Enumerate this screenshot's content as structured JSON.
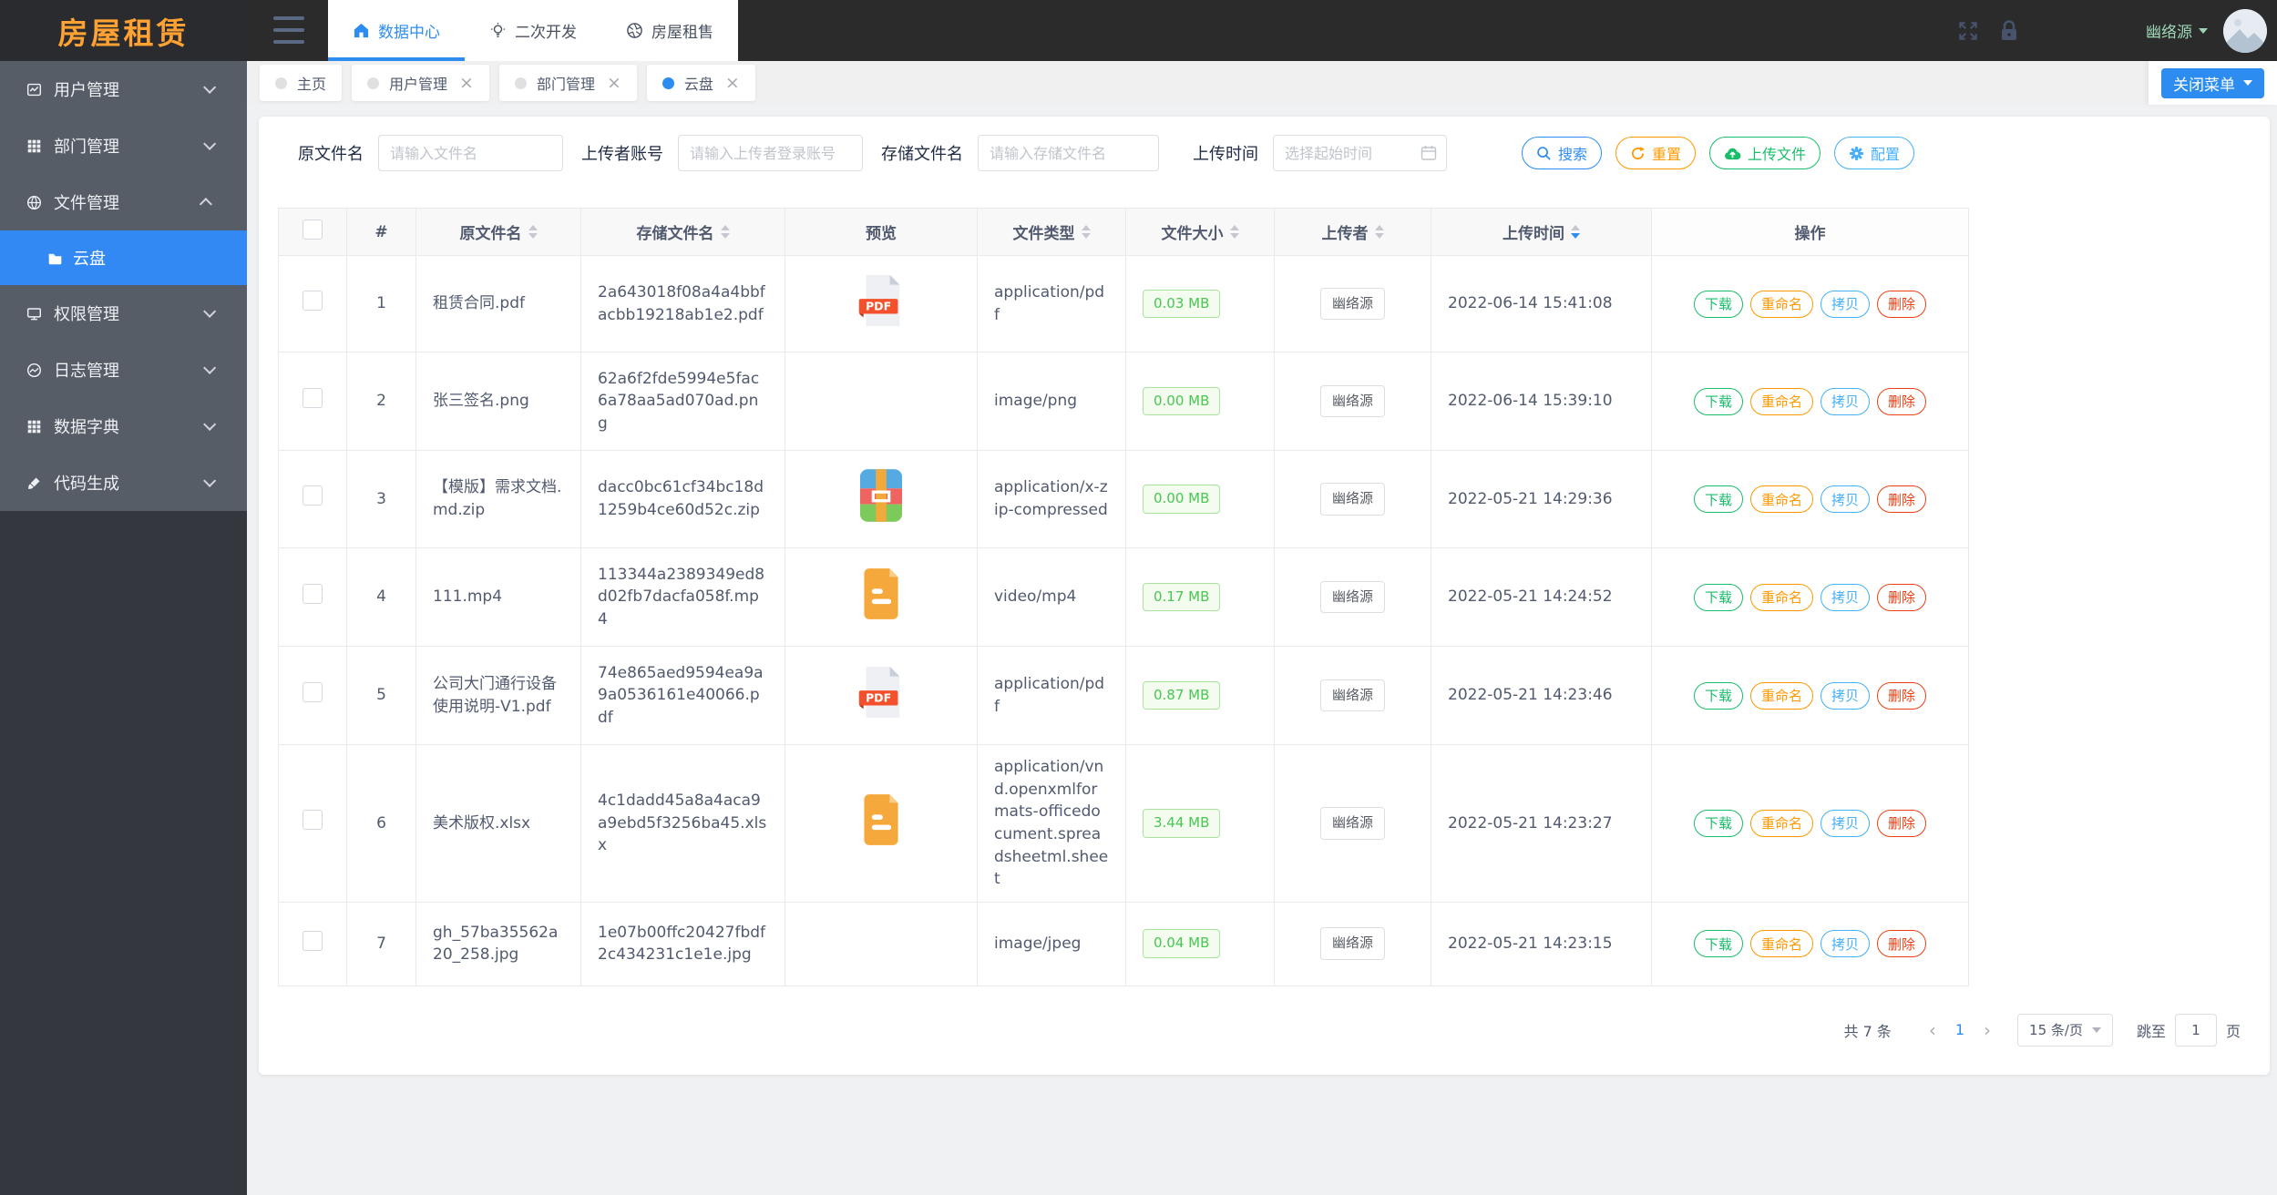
{
  "app": {
    "logo": "房屋租赁"
  },
  "topbar": {
    "nav": [
      {
        "label": "数据中心",
        "icon": "home-icon"
      },
      {
        "label": "二次开发",
        "icon": "bulb-icon"
      },
      {
        "label": "房屋租售",
        "icon": "aperture-icon"
      }
    ],
    "username": "幽络源"
  },
  "tagbar": {
    "tabs": [
      {
        "label": "主页",
        "active": false,
        "closable": false
      },
      {
        "label": "用户管理",
        "active": false,
        "closable": true
      },
      {
        "label": "部门管理",
        "active": false,
        "closable": true
      },
      {
        "label": "云盘",
        "active": true,
        "closable": true
      }
    ],
    "close_icon": "×",
    "close_menu": "关闭菜单"
  },
  "sidebar": {
    "items": [
      {
        "label": "用户管理",
        "icon": "chart-icon",
        "state": "collapsed"
      },
      {
        "label": "部门管理",
        "icon": "grid-icon",
        "state": "collapsed"
      },
      {
        "label": "文件管理",
        "icon": "basketball-icon",
        "state": "expanded"
      },
      {
        "label": "权限管理",
        "icon": "monitor-icon",
        "state": "collapsed"
      },
      {
        "label": "日志管理",
        "icon": "pie-chart-icon",
        "state": "collapsed"
      },
      {
        "label": "数据字典",
        "icon": "dict-grid-icon",
        "state": "collapsed"
      },
      {
        "label": "代码生成",
        "icon": "brush-icon",
        "state": "collapsed"
      }
    ],
    "submenu": {
      "label": "云盘",
      "icon": "folder-icon",
      "active": true
    }
  },
  "filters": {
    "name": {
      "label": "原文件名",
      "placeholder": "请输入文件名"
    },
    "uploader": {
      "label": "上传者账号",
      "placeholder": "请输入上传者登录账号"
    },
    "storage": {
      "label": "存储文件名",
      "placeholder": "请输入存储文件名"
    },
    "time": {
      "label": "上传时间",
      "placeholder": "选择起始时间"
    }
  },
  "toolbar": {
    "search": "搜索",
    "reset": "重置",
    "upload": "上传文件",
    "config": "配置"
  },
  "icons": {
    "pdf_label": "PDF"
  },
  "table": {
    "columns": [
      {
        "label": ""
      },
      {
        "label": "#"
      },
      {
        "label": "原文件名",
        "sortable": true
      },
      {
        "label": "存储文件名",
        "sortable": true
      },
      {
        "label": "预览"
      },
      {
        "label": "文件类型",
        "sortable": true
      },
      {
        "label": "文件大小",
        "sortable": true
      },
      {
        "label": "上传者",
        "sortable": true
      },
      {
        "label": "上传时间",
        "sortable": true,
        "sorted": "desc"
      },
      {
        "label": "操作"
      }
    ],
    "actions": {
      "download": "下载",
      "rename": "重命名",
      "copy": "拷贝",
      "delete": "删除"
    },
    "rows": [
      {
        "index": "1",
        "name": "租赁合同.pdf",
        "storage": "2a643018f08a4a4bbfacbb19218ab1e2.pdf",
        "preview": "pdf",
        "type": "application/pdf",
        "size": "0.03 MB",
        "uploader": "幽络源",
        "time": "2022-06-14 15:41:08"
      },
      {
        "index": "2",
        "name": "张三签名.png",
        "storage": "62a6f2fde5994e5fac6a78aa5ad070ad.png",
        "preview": "none",
        "type": "image/png",
        "size": "0.00 MB",
        "uploader": "幽络源",
        "time": "2022-06-14 15:39:10"
      },
      {
        "index": "3",
        "name": "【模版】需求文档.md.zip",
        "storage": "dacc0bc61cf34bc18d1259b4ce60d52c.zip",
        "preview": "zip",
        "type": "application/x-zip-compressed",
        "size": "0.00 MB",
        "uploader": "幽络源",
        "time": "2022-05-21 14:29:36"
      },
      {
        "index": "4",
        "name": "111.mp4",
        "storage": "113344a2389349ed8d02fb7dacfa058f.mp4",
        "preview": "doc",
        "type": "video/mp4",
        "size": "0.17 MB",
        "uploader": "幽络源",
        "time": "2022-05-21 14:24:52"
      },
      {
        "index": "5",
        "name": "公司大门通行设备使用说明-V1.pdf",
        "storage": "74e865aed9594ea9a9a0536161e40066.pdf",
        "preview": "pdf",
        "type": "application/pdf",
        "size": "0.87 MB",
        "uploader": "幽络源",
        "time": "2022-05-21 14:23:46"
      },
      {
        "index": "6",
        "name": "美术版权.xlsx",
        "storage": "4c1dadd45a8a4aca9a9ebd5f3256ba45.xlsx",
        "preview": "doc",
        "type": "application/vnd.openxmlformats-officedocument.spreadsheetml.sheet",
        "size": "3.44 MB",
        "uploader": "幽络源",
        "time": "2022-05-21 14:23:27"
      },
      {
        "index": "7",
        "name": "gh_57ba35562a20_258.jpg",
        "storage": "1e07b00ffc20427fbdf2c434231c1e1e.jpg",
        "preview": "none",
        "type": "image/jpeg",
        "size": "0.04 MB",
        "uploader": "幽络源",
        "time": "2022-05-21 14:23:15"
      }
    ]
  },
  "pagination": {
    "total": "共 7 条",
    "prev": "‹",
    "page": "1",
    "next": "›",
    "page_size": "15 条/页",
    "jump_label": "跳至",
    "jump_value": "1",
    "page_suffix": "页"
  },
  "colors": {
    "accent": "#2d8cf0",
    "success": "#19be6b",
    "warning": "#ff9900",
    "error": "#ed4014",
    "info": "#45b0f7",
    "logo": "#ffa133"
  }
}
